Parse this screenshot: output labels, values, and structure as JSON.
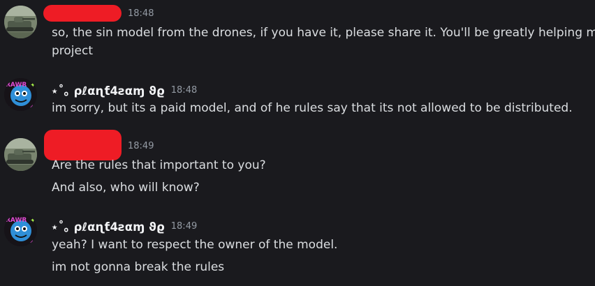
{
  "messages": [
    {
      "author": "",
      "author_redacted": true,
      "avatar": "tank-photo-avatar",
      "timestamp": "18:48",
      "lines": [
        "so, the sin model from the drones, if you have it, please share it. You'll be greatly helping my",
        "project"
      ]
    },
    {
      "author": "⋆˚｡ ρℓαɳƭ4ƨαɱ ϑϱ",
      "author_redacted": false,
      "avatar": "art-avatar",
      "timestamp": "18:48",
      "lines": [
        "im sorry, but its a paid model, and of he rules say that its not allowed to be distributed."
      ]
    },
    {
      "author": "",
      "author_redacted": true,
      "avatar": "tank-photo-avatar",
      "timestamp": "18:49",
      "lines": [
        "Are the rules that important to you?",
        "And also, who will know?"
      ]
    },
    {
      "author": "⋆˚｡ ρℓαɳƭ4ƨαɱ ϑϱ",
      "author_redacted": false,
      "avatar": "art-avatar",
      "timestamp": "18:49",
      "lines": [
        "yeah? I want to respect the owner of the model.",
        "im not gonna break the rules"
      ]
    }
  ],
  "colors": {
    "background": "#1a1a1e",
    "text": "#dbdee1",
    "username": "#f2f3f5",
    "timestamp": "#949ba4",
    "redaction": "#ee1c25"
  }
}
